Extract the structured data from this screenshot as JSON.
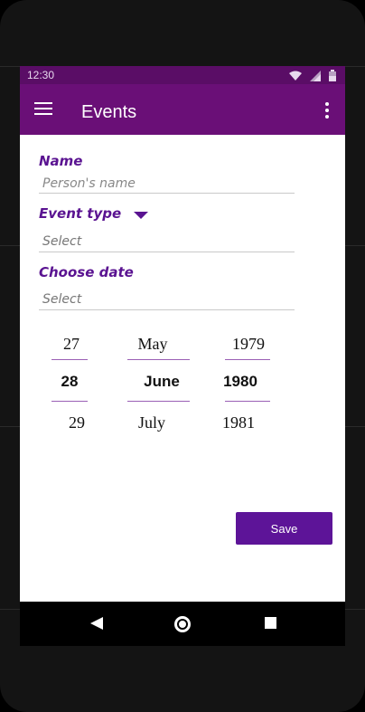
{
  "status": {
    "time": "12:30"
  },
  "appbar": {
    "title": "Events"
  },
  "form": {
    "name": {
      "label": "Name",
      "placeholder": "Person's name",
      "value": ""
    },
    "event_type": {
      "label": "Event type",
      "selected": "Select"
    },
    "date": {
      "label": "Choose date",
      "selected": "Select"
    }
  },
  "picker": {
    "day": [
      "27",
      "28",
      "29"
    ],
    "month": [
      "May",
      "June",
      "July"
    ],
    "year": [
      "1979",
      "1980",
      "1981"
    ]
  },
  "actions": {
    "save_label": "Save"
  },
  "colors": {
    "appbar": "#6a0f77",
    "statusbar": "#5a0d66",
    "accent": "#5a1391",
    "button": "#5d1498"
  },
  "icons": [
    "menu-icon",
    "overflow-menu-icon",
    "wifi-icon",
    "signal-icon",
    "battery-icon",
    "back-icon",
    "home-icon",
    "recents-icon"
  ]
}
